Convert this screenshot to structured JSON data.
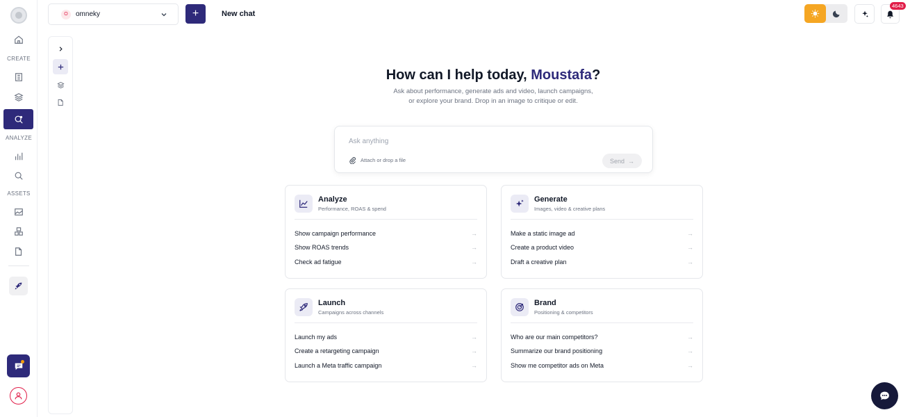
{
  "rail": {
    "labels": {
      "create": "CREATE",
      "analyze": "ANALYZE",
      "assets": "ASSETS"
    }
  },
  "topbar": {
    "workspace_initial": "O",
    "workspace_name": "omneky",
    "new_button_label": "+",
    "chat_title": "New chat",
    "notification_count": "4643"
  },
  "hero": {
    "greeting": "How can I help today, ",
    "name": "Moustafa",
    "punct": "?",
    "subtitle": "Ask about performance, generate ads and video, launch campaigns, or explore your brand. Drop in an image to critique or edit."
  },
  "composer": {
    "placeholder": "Ask anything",
    "attach_label": "Attach or drop a file",
    "send_label": "Send",
    "send_arrow": "→"
  },
  "cards": [
    {
      "title": "Analyze",
      "subtitle": "Performance, ROAS & spend",
      "icon": "chart-icon",
      "items": [
        "Show campaign performance",
        "Show ROAS trends",
        "Check ad fatigue"
      ]
    },
    {
      "title": "Generate",
      "subtitle": "Images, video & creative plans",
      "icon": "sparkles-icon",
      "items": [
        "Make a static image ad",
        "Create a product video",
        "Draft a creative plan"
      ]
    },
    {
      "title": "Launch",
      "subtitle": "Campaigns across channels",
      "icon": "rocket-icon",
      "items": [
        "Launch my ads",
        "Create a retargeting campaign",
        "Launch a Meta traffic campaign"
      ]
    },
    {
      "title": "Brand",
      "subtitle": "Positioning & competitors",
      "icon": "target-icon",
      "items": [
        "Who are our main competitors?",
        "Summarize our brand positioning",
        "Show me competitor ads on Meta"
      ]
    }
  ],
  "item_arrow": "→",
  "colors": {
    "accent": "#2e2a7a",
    "sun": "#f5a623",
    "badge": "#e11d48"
  }
}
